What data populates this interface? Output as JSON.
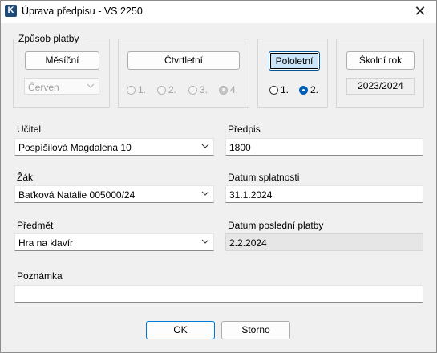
{
  "window": {
    "title": "Úprava předpisu - VS 2250",
    "app_icon_letter": "K",
    "close_glyph": "✕"
  },
  "payment": {
    "group_label": "Způsob platby",
    "monthly": {
      "button": "Měsíční",
      "month_value": "Červen"
    },
    "quarterly": {
      "button": "Čtvrtletní",
      "options": [
        "1.",
        "2.",
        "3.",
        "4."
      ]
    },
    "half_yearly": {
      "button": "Pololetní",
      "options": [
        "1.",
        "2."
      ]
    },
    "school_year": {
      "button": "Školní rok",
      "value": "2023/2024"
    }
  },
  "fields": {
    "teacher": {
      "label": "Učitel",
      "value": "Pospíšilová Magdalena 10"
    },
    "student": {
      "label": "Žák",
      "value": "Baťková Natálie 005000/24"
    },
    "subject": {
      "label": "Předmět",
      "value": "Hra na klavír"
    },
    "prescription": {
      "label": "Předpis",
      "value": "1800"
    },
    "due_date": {
      "label": "Datum splatnosti",
      "value": "31.1.2024"
    },
    "last_payment": {
      "label": "Datum poslední platby",
      "value": "2.2.2024"
    },
    "note": {
      "label": "Poznámka",
      "value": ""
    }
  },
  "buttons": {
    "ok": "OK",
    "cancel": "Storno"
  }
}
